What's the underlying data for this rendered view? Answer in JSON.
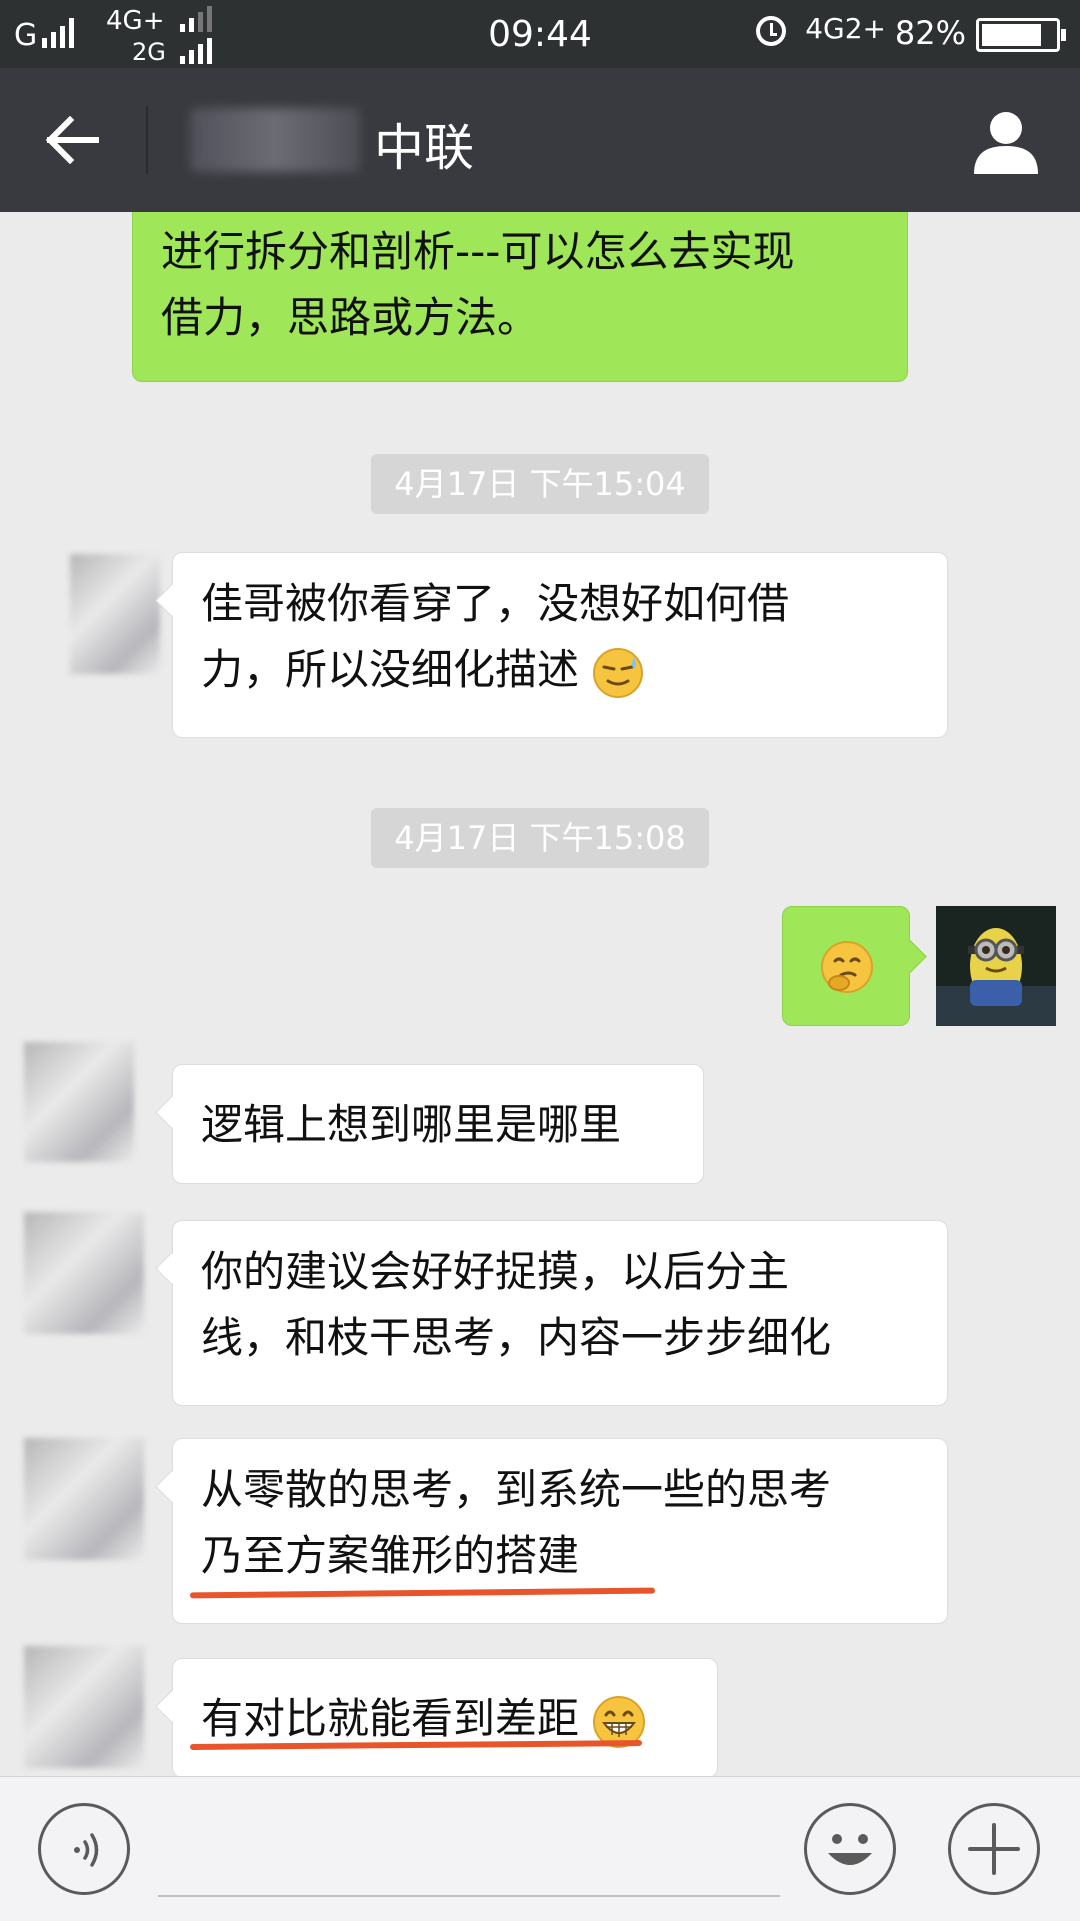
{
  "status_bar": {
    "carrier1": "G",
    "carrier2_top": "4G+",
    "carrier2_bottom": "2G",
    "time": "09:44",
    "network_right": "4G2+",
    "battery_percent": "82%",
    "battery_level": 0.82,
    "icons": [
      "signal-icon",
      "alarm-icon",
      "battery-icon"
    ]
  },
  "header": {
    "title": "中联",
    "back_icon": "back-arrow-icon",
    "profile_icon": "profile-icon"
  },
  "messages": [
    {
      "type": "out",
      "lines": [
        "进行拆分和剖析---可以怎么去实现",
        "借力，思路或方法。"
      ]
    },
    {
      "type": "timestamp",
      "text": "4月17日 下午15:04"
    },
    {
      "type": "in",
      "lines": [
        "佳哥被你看穿了，没想好如何借",
        "力，所以没细化描述"
      ],
      "emoji": "sweat-smile-emoji"
    },
    {
      "type": "timestamp",
      "text": "4月17日 下午15:08"
    },
    {
      "type": "out",
      "emoji": "thinking-emoji"
    },
    {
      "type": "in",
      "lines": [
        "逻辑上想到哪里是哪里"
      ]
    },
    {
      "type": "in",
      "lines": [
        "你的建议会好好捉摸，以后分主",
        "线，和枝干思考，内容一步步细化"
      ]
    },
    {
      "type": "in",
      "lines": [
        "从零散的思考，到系统一些的思考",
        "乃至方案雏形的搭建"
      ],
      "underlined_line": 1
    },
    {
      "type": "in",
      "lines": [
        "有对比就能看到差距"
      ],
      "emoji": "grin-emoji",
      "underlined_line": 0
    }
  ],
  "input_bar": {
    "voice_icon": "voice-icon",
    "emoji_icon": "emoji-icon",
    "plus_icon": "plus-icon",
    "placeholder": ""
  },
  "colors": {
    "status_bar": "#2e3132",
    "title_bar": "#393a3f",
    "chat_bg": "#ebebeb",
    "outgoing_bubble": "#9fe658",
    "incoming_bubble": "#ffffff",
    "underline": "#e8552a"
  }
}
